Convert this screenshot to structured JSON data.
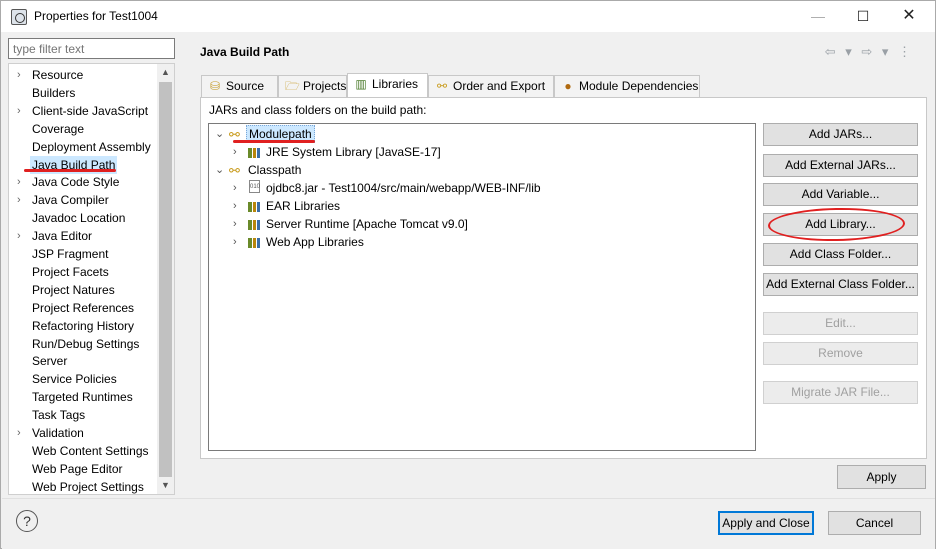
{
  "window": {
    "title": "Properties for Test1004"
  },
  "filter": {
    "placeholder": "type filter text"
  },
  "nav": {
    "items": [
      {
        "label": "Resource",
        "arrow": true
      },
      {
        "label": "Builders"
      },
      {
        "label": "Client-side JavaScript",
        "arrow": true
      },
      {
        "label": "Coverage"
      },
      {
        "label": "Deployment Assembly"
      },
      {
        "label": "Java Build Path",
        "selected": true
      },
      {
        "label": "Java Code Style",
        "arrow": true
      },
      {
        "label": "Java Compiler",
        "arrow": true
      },
      {
        "label": "Javadoc Location"
      },
      {
        "label": "Java Editor",
        "arrow": true
      },
      {
        "label": "JSP Fragment"
      },
      {
        "label": "Project Facets"
      },
      {
        "label": "Project Natures"
      },
      {
        "label": "Project References"
      },
      {
        "label": "Refactoring History"
      },
      {
        "label": "Run/Debug Settings"
      },
      {
        "label": "Server"
      },
      {
        "label": "Service Policies"
      },
      {
        "label": "Targeted Runtimes"
      },
      {
        "label": "Task Tags"
      },
      {
        "label": "Validation",
        "arrow": true
      },
      {
        "label": "Web Content Settings"
      },
      {
        "label": "Web Page Editor"
      },
      {
        "label": "Web Project Settings"
      }
    ]
  },
  "panel": {
    "title": "Java Build Path"
  },
  "tabs": [
    {
      "label": "Source",
      "icon": "source-folder-icon"
    },
    {
      "label": "Projects",
      "icon": "projects-folder-icon"
    },
    {
      "label": "Libraries",
      "icon": "libraries-icon",
      "active": true
    },
    {
      "label": "Order and Export",
      "icon": "order-export-icon"
    },
    {
      "label": "Module Dependencies",
      "icon": "module-dependencies-icon"
    }
  ],
  "libraries": {
    "caption": "JARs and class folders on the build path:",
    "tree": {
      "modulepath": "Modulepath",
      "jre": "JRE System Library [JavaSE-17]",
      "classpath": "Classpath",
      "ojdbc": "ojdbc8.jar - Test1004/src/main/webapp/WEB-INF/lib",
      "ear": "EAR Libraries",
      "server": "Server Runtime [Apache Tomcat v9.0]",
      "webapp": "Web App Libraries"
    },
    "buttons": {
      "add_jars": "Add JARs...",
      "add_external_jars": "Add External JARs...",
      "add_variable": "Add Variable...",
      "add_library": "Add Library...",
      "add_class_folder": "Add Class Folder...",
      "add_external_class_folder": "Add External Class Folder...",
      "edit": "Edit...",
      "remove": "Remove",
      "migrate": "Migrate JAR File..."
    }
  },
  "apply": "Apply",
  "footer": {
    "apply_close": "Apply and Close",
    "cancel": "Cancel",
    "help": "?"
  },
  "annotation_color": "#e02020"
}
